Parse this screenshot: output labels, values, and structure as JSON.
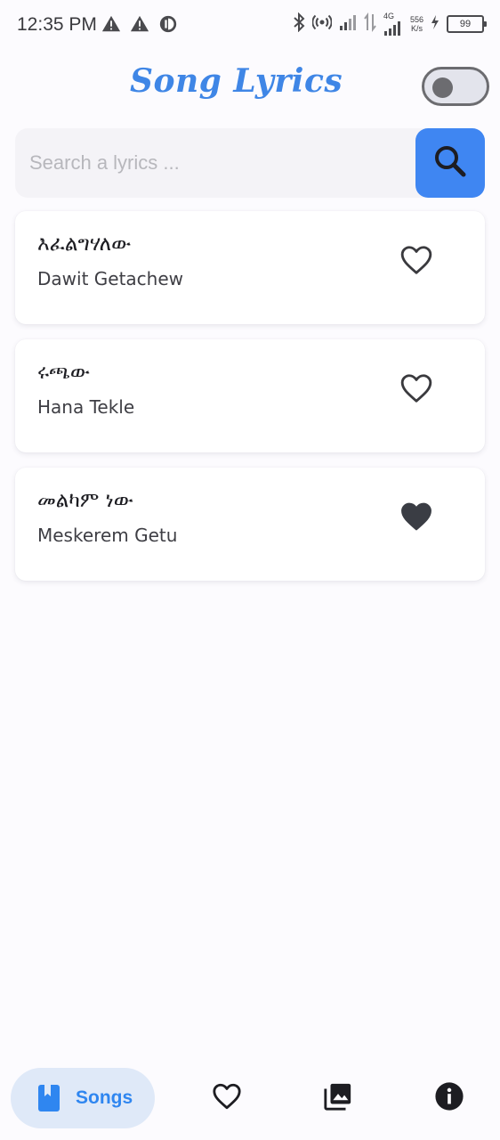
{
  "status_bar": {
    "time": "12:35 PM",
    "net_speed_value": "556",
    "net_speed_unit": "K/s",
    "network_label": "4G",
    "battery": "99",
    "left_icons": [
      "warning-icon",
      "warning-icon",
      "data-saver-icon"
    ],
    "right_icons": [
      "bluetooth-icon",
      "hotspot-icon",
      "signal-icon",
      "data-transfer-icon",
      "signal-4g-icon",
      "charging-icon",
      "battery-icon"
    ]
  },
  "header": {
    "title": "Song Lyrics",
    "title_color": "#3f86e6",
    "theme_toggle_on": false
  },
  "search": {
    "placeholder": "Search a lyrics ...",
    "value": "",
    "button_icon": "search-icon",
    "button_color": "#3f86f2"
  },
  "songs": [
    {
      "title": "እፈልግሃለው",
      "artist": "Dawit Getachew",
      "favorite": false
    },
    {
      "title": "ሩጫው",
      "artist": "Hana Tekle",
      "favorite": false
    },
    {
      "title": "መልካም ነው",
      "artist": "Meskerem Getu",
      "favorite": true
    }
  ],
  "bottom_nav": {
    "items": [
      {
        "label": "Songs",
        "icon": "book-icon",
        "active": true
      },
      {
        "label": "",
        "icon": "heart-icon",
        "active": false
      },
      {
        "label": "",
        "icon": "gallery-icon",
        "active": false
      },
      {
        "label": "",
        "icon": "info-icon",
        "active": false
      }
    ],
    "active_color": "#2f86f0",
    "active_bg": "#dfe9f8"
  }
}
